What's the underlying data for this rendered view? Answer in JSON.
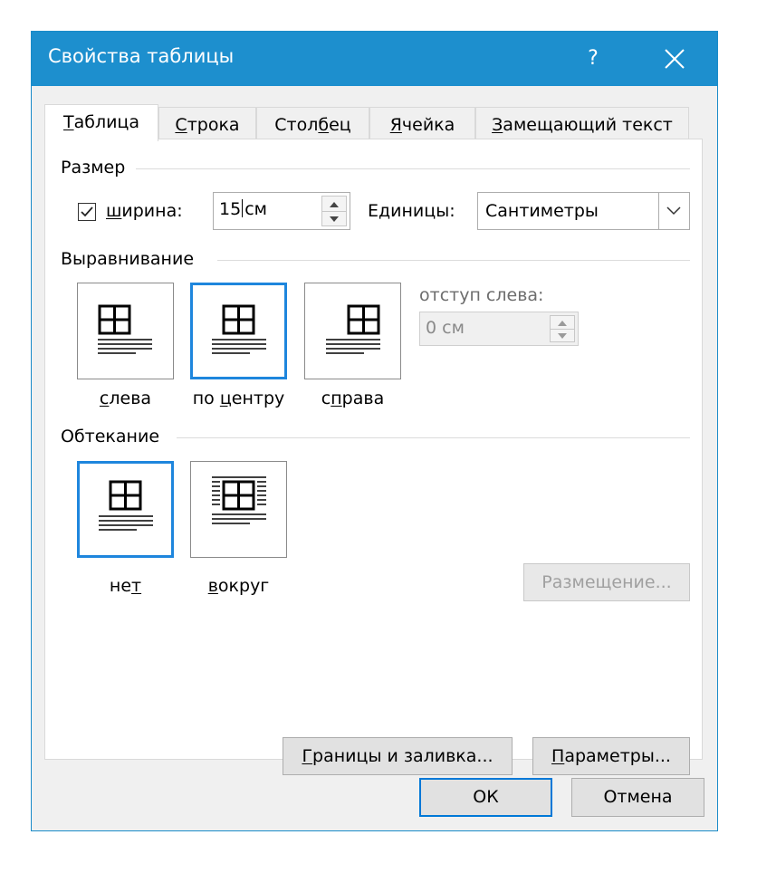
{
  "window": {
    "title": "Свойства таблицы",
    "help_label": "?",
    "close_label": "✕"
  },
  "tabs": [
    {
      "label": "Таблица",
      "underline": "Т",
      "rest": "аблица",
      "active": true
    },
    {
      "label": "Строка",
      "pre": "",
      "underline": "С",
      "rest": "трока"
    },
    {
      "label": "Столбец",
      "pre": "Стол",
      "underline": "б",
      "rest": "ец"
    },
    {
      "label": "Ячейка",
      "pre": "",
      "underline": "Я",
      "rest": "чейка"
    },
    {
      "label": "Замещающий текст",
      "pre": "",
      "underline": "З",
      "rest": "амещающий текст"
    }
  ],
  "size": {
    "group_label": "Размер",
    "width_checked": true,
    "width_label_u": "ш",
    "width_label_rest": "ирина:",
    "width_value": "15 см",
    "width_value_a": "15",
    "width_value_b": "см",
    "units_label": "Единицы:",
    "units_value": "Сантиметры"
  },
  "alignment": {
    "group_label": "Выравнивание",
    "options": [
      {
        "pre": "",
        "u": "с",
        "rest": "лева",
        "label": "слева",
        "selected": false
      },
      {
        "pre": "по ",
        "u": "ц",
        "rest": "ентру",
        "label": "по центру",
        "selected": true
      },
      {
        "pre": "с",
        "u": "п",
        "rest": "рава",
        "label": "справа",
        "selected": false
      }
    ],
    "indent_label": "отступ слева:",
    "indent_value": "0 см"
  },
  "wrapping": {
    "group_label": "Обтекание",
    "options": [
      {
        "pre": "не",
        "u": "т",
        "rest": "",
        "label": "нет",
        "selected": true
      },
      {
        "pre": "",
        "u": "в",
        "rest": "округ",
        "label": "вокруг",
        "selected": false
      }
    ],
    "positioning_label": "Размещение..."
  },
  "bottom_buttons": {
    "borders_u": "Г",
    "borders_rest": "раницы и заливка...",
    "borders": "Границы и заливка...",
    "options_u": "П",
    "options_rest": "араметры...",
    "options": "Параметры..."
  },
  "dialog_buttons": {
    "ok": "ОК",
    "cancel": "Отмена"
  },
  "colors": {
    "titlebar": "#1d8fce",
    "selection": "#1e86dd"
  }
}
